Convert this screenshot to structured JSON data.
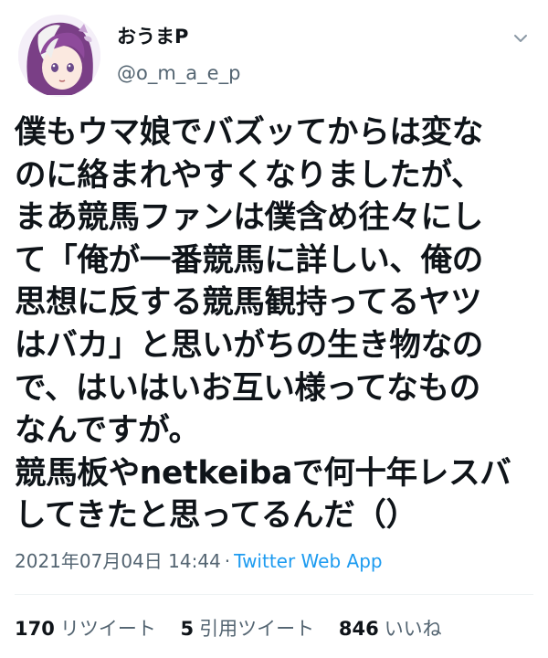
{
  "author": {
    "display_name": "おうまP",
    "handle": "@o_m_a_e_p",
    "avatar": "anime-character-avatar"
  },
  "menu_icon": "chevron-down-icon",
  "tweet": {
    "lines": [
      "僕もウマ娘でバズッてからは変な",
      "のに絡まれやすくなりましたが、",
      "まあ競馬ファンは僕含め往々にし",
      "て「俺が一番競馬に詳しい、俺の",
      "思想に反する競馬観持ってるヤツ",
      "はバカ」と思いがちの生き物なの",
      "で、はいはいお互い様ってなもの",
      "なんですが。",
      "競馬板やnetkeibaで何十年レスバ",
      "してきたと思ってるんだ（）"
    ]
  },
  "meta": {
    "timestamp": "2021年07月04日 14:44",
    "separator": "·",
    "source": "Twitter Web App"
  },
  "stats": {
    "retweets": {
      "count": "170",
      "label": "リツイート"
    },
    "quotes": {
      "count": "5",
      "label": "引用ツイート"
    },
    "likes": {
      "count": "846",
      "label": "いいね"
    }
  },
  "colors": {
    "text": "#0f1419",
    "secondary": "#536471",
    "link": "#1d9bf0",
    "divider": "#eff3f4"
  }
}
